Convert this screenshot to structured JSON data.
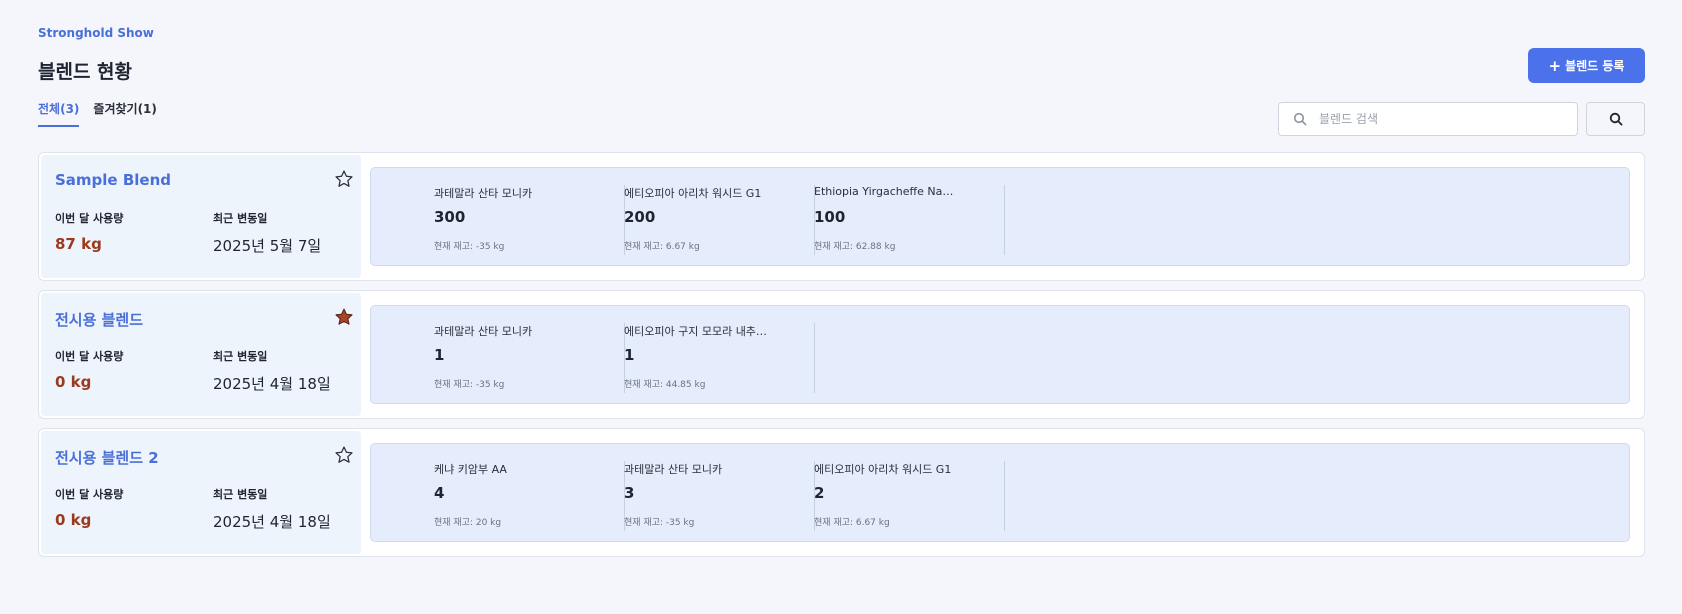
{
  "header": {
    "brand": "Stronghold Show",
    "title": "블렌드 현황",
    "add_button": "블렌드 등록"
  },
  "tabs": [
    {
      "label": "전체(3)",
      "active": true
    },
    {
      "label": "즐겨찾기(1)",
      "active": false
    }
  ],
  "search": {
    "placeholder": "블렌드 검색",
    "value": ""
  },
  "labels": {
    "usage": "이번 달 사용량",
    "last_changed": "최근 변동일"
  },
  "colors": {
    "accent": "#4b72ea",
    "usage_value": "#9a3b1f",
    "star_filled": "#a8442a"
  },
  "blends": [
    {
      "name": "Sample Blend",
      "favorite": false,
      "usage": "87 kg",
      "last_changed": "2025년 5월 7일",
      "beans": [
        {
          "name": "과테말라 산타 모니카",
          "qty": "300",
          "stock": "현재 재고: -35 kg"
        },
        {
          "name": "에티오피아 아리차 워시드 G1",
          "qty": "200",
          "stock": "현재 재고: 6.67 kg"
        },
        {
          "name": "Ethiopia Yirgacheffe Na…",
          "qty": "100",
          "stock": "현재 재고: 62.88 kg"
        }
      ]
    },
    {
      "name": "전시용 블렌드",
      "favorite": true,
      "usage": "0 kg",
      "last_changed": "2025년 4월 18일",
      "beans": [
        {
          "name": "과테말라 산타 모니카",
          "qty": "1",
          "stock": "현재 재고: -35 kg"
        },
        {
          "name": "에티오피아 구지 모모라 내추…",
          "qty": "1",
          "stock": "현재 재고: 44.85 kg"
        }
      ]
    },
    {
      "name": "전시용 블렌드 2",
      "favorite": false,
      "usage": "0 kg",
      "last_changed": "2025년 4월 18일",
      "beans": [
        {
          "name": "케냐 키암부 AA",
          "qty": "4",
          "stock": "현재 재고: 20 kg"
        },
        {
          "name": "과테말라 산타 모니카",
          "qty": "3",
          "stock": "현재 재고: -35 kg"
        },
        {
          "name": "에티오피아 아리차 워시드 G1",
          "qty": "2",
          "stock": "현재 재고: 6.67 kg"
        }
      ]
    }
  ]
}
